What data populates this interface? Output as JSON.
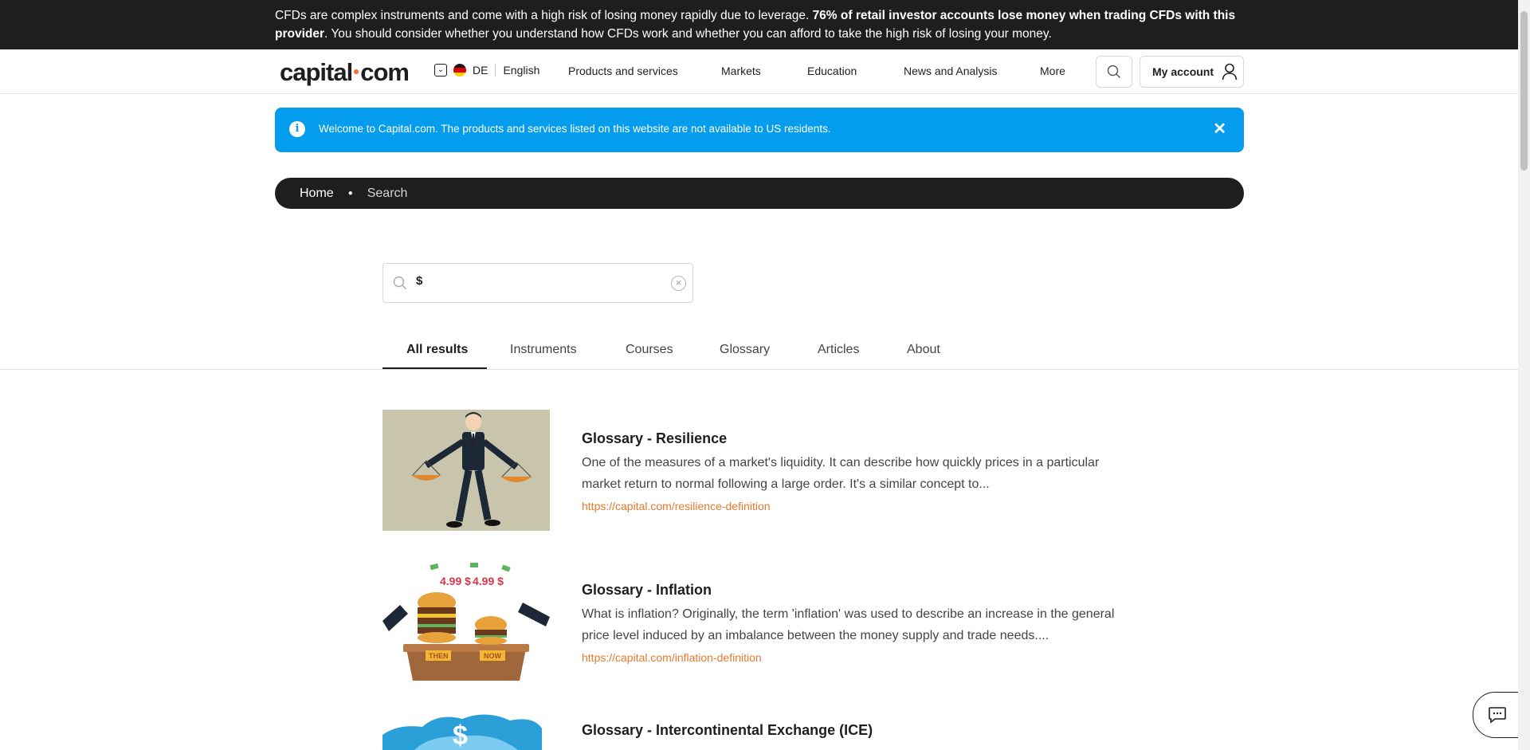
{
  "risk_banner": {
    "text_start": "CFDs are complex instruments and come with a high risk of losing money rapidly due to leverage. ",
    "text_bold": "76% of retail investor accounts lose money when trading CFDs with this provider",
    "text_end": ". You should consider whether you understand how CFDs work and whether you can afford to take the high risk of losing your money."
  },
  "header": {
    "logo_left": "capital",
    "logo_right": "com",
    "country_code": "DE",
    "language": "English",
    "nav": [
      "Products and services",
      "Markets",
      "Education",
      "News and Analysis",
      "More"
    ],
    "account_label": "My account"
  },
  "info_bar": {
    "text": "Welcome to Capital.com. The products and services listed on this website are not available to US residents."
  },
  "breadcrumb": {
    "home": "Home",
    "current": "Search"
  },
  "search": {
    "value": "$"
  },
  "tabs": [
    "All results",
    "Instruments",
    "Courses",
    "Glossary",
    "Articles",
    "About"
  ],
  "results": [
    {
      "title": "Glossary - Resilience",
      "desc": "One of the measures of a market's liquidity. It can describe how quickly prices in a particular market return to normal following a large order. It's a similar concept to...",
      "link": "https://capital.com/resilience-definition"
    },
    {
      "title": "Glossary - Inflation",
      "desc": "What is inflation? Originally, the term 'inflation' was used to describe an increase in the general price level induced by an imbalance between the money supply and trade needs....",
      "link": "https://capital.com/inflation-definition",
      "thumb_labels": {
        "price_left": "4.99 $",
        "price_right": "4.99 $",
        "then": "THEN",
        "now": "NOW"
      }
    },
    {
      "title": "Glossary - Intercontinental Exchange (ICE)"
    }
  ],
  "colors": {
    "banner_bg": "#1e1e1e",
    "info_bg": "#049ded",
    "link": "#e47a2e",
    "logo_dot": "#f76d2b"
  }
}
